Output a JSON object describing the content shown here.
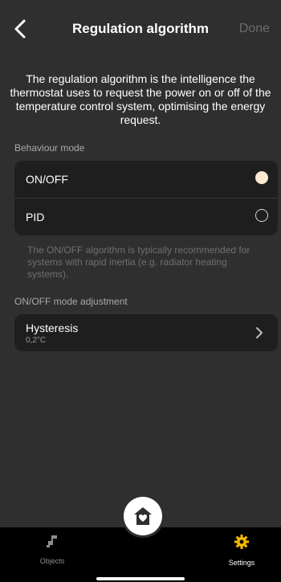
{
  "navbar": {
    "title": "Regulation algorithm",
    "done_label": "Done",
    "back_icon": "chevron-left-icon"
  },
  "intro_text": "The regulation algorithm is the intelligence the thermostat uses to request the power on or off of the temperature control system, optimising the energy request.",
  "behaviour": {
    "section_label": "Behaviour mode",
    "options": [
      {
        "label": "ON/OFF",
        "selected": true
      },
      {
        "label": "PID",
        "selected": false
      }
    ],
    "hint": "The ON/OFF algorithm is typically recommended for systems with rapid inertia (e.g. radiator heating systems)."
  },
  "adjustment": {
    "section_label": "ON/OFF mode adjustment",
    "hysteresis_title": "Hysteresis",
    "hysteresis_value": "0,2°C"
  },
  "tabbar": {
    "objects_label": "Objects",
    "settings_label": "Settings",
    "objects_icon": "plug-icon",
    "settings_icon": "gear-icon",
    "home_icon": "home-heart-icon"
  },
  "colors": {
    "background": "#2f2f2f",
    "card": "#1e1e1e",
    "accent": "#f5b800",
    "radio_selected": "#fbe9d2",
    "muted_text": "#6f6f6f"
  }
}
